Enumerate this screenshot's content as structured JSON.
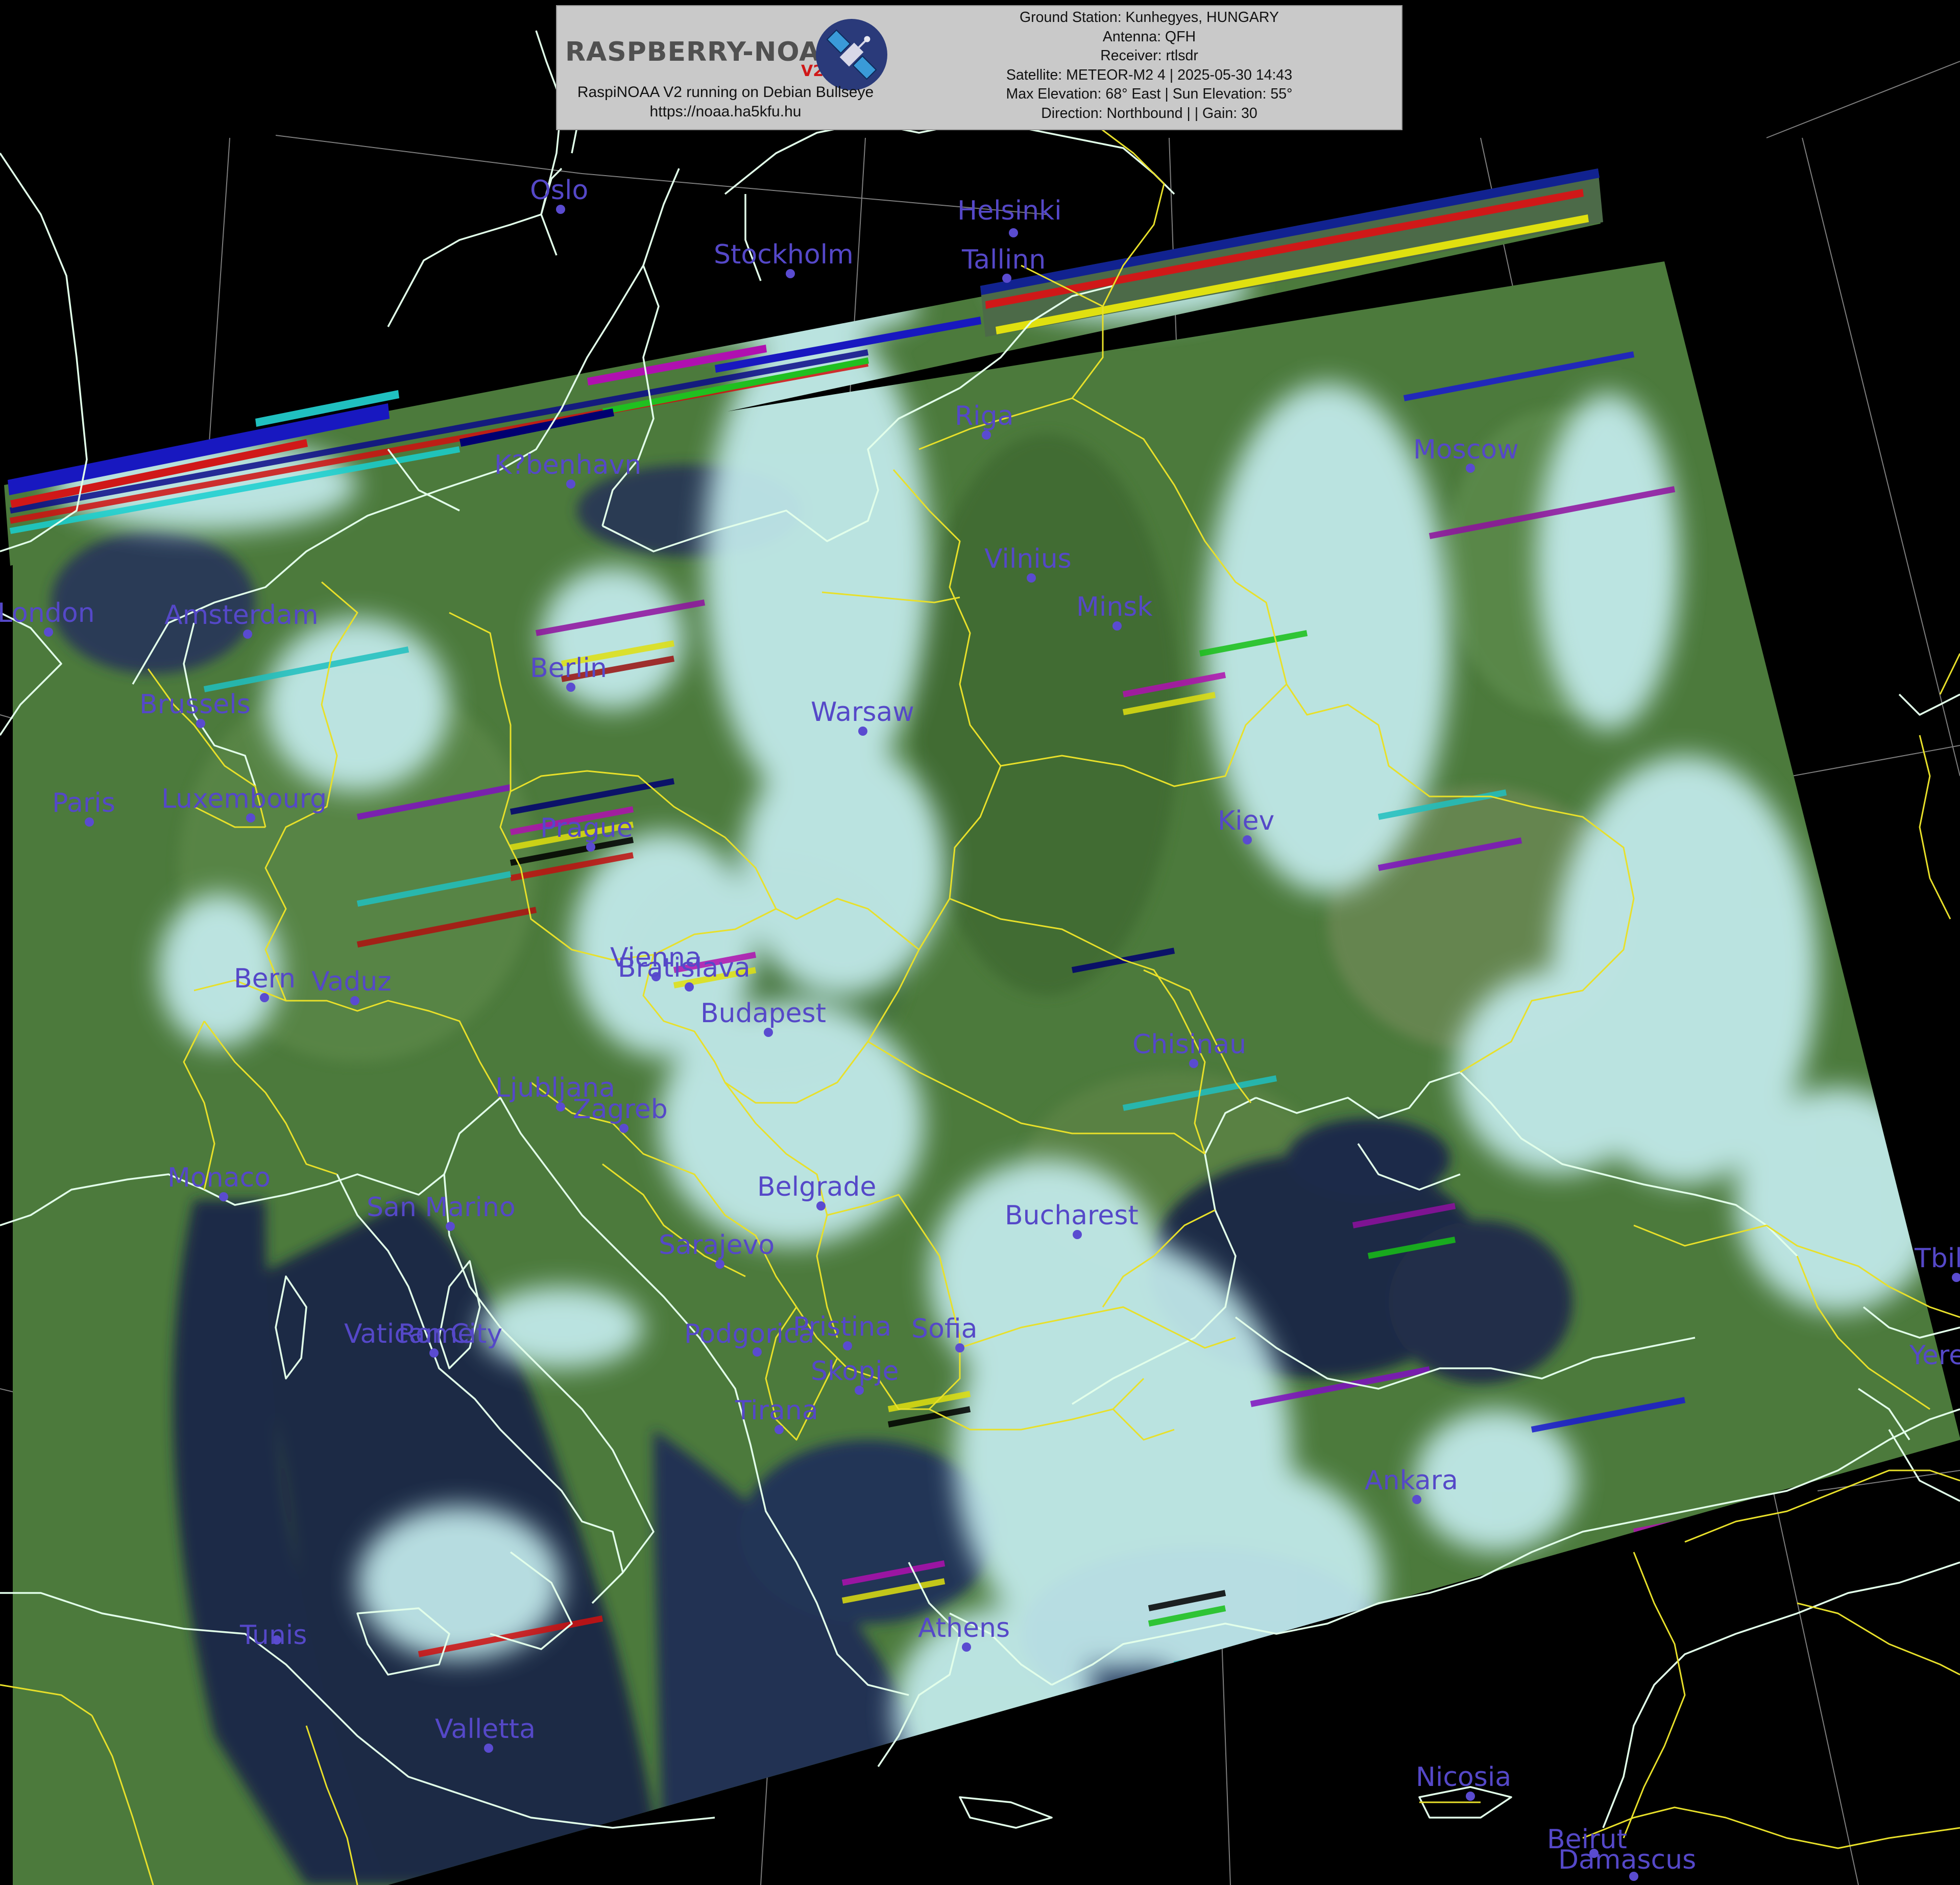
{
  "header": {
    "logo_text": "RASPBERRY-NOAA",
    "logo_badge": "V2",
    "subtitle_line1": "RaspiNOAA V2 running on Debian Bullseye",
    "subtitle_line2": "https://noaa.ha5kfu.hu",
    "ground_station": "Ground Station: Kunhegyes, HUNGARY",
    "antenna": "Antenna: QFH",
    "receiver": "Receiver: rtlsdr",
    "satellite": "Satellite: METEOR-M2 4 | 2025-05-30 14:43",
    "elevation": "Max Elevation: 68° East | Sun Elevation: 55°",
    "direction": "Direction: Northbound | | Gain: 30"
  },
  "colors": {
    "city_label": "#5548c8",
    "city_dot": "#5a4bd0",
    "coastline": "#d8ffe8",
    "border": "#e8e02a",
    "graticule": "#9a9a9a",
    "land": "#4e7a3e",
    "cloud": "#c6ecee",
    "sea": "#1a2942",
    "background": "#000000"
  },
  "cities": [
    {
      "name": "Oslo"
    },
    {
      "name": "Helsinki"
    },
    {
      "name": "Stockholm"
    },
    {
      "name": "Tallinn"
    },
    {
      "name": "Riga"
    },
    {
      "name": "Moscow"
    },
    {
      "name": "K?benhavn"
    },
    {
      "name": "Vilnius"
    },
    {
      "name": "Minsk"
    },
    {
      "name": "London"
    },
    {
      "name": "Amsterdam"
    },
    {
      "name": "Berlin"
    },
    {
      "name": "Brussels"
    },
    {
      "name": "Warsaw"
    },
    {
      "name": "Paris"
    },
    {
      "name": "Luxembourg"
    },
    {
      "name": "Kiev"
    },
    {
      "name": "Prague"
    },
    {
      "name": "Vienna"
    },
    {
      "name": "Bratislava"
    },
    {
      "name": "Bern"
    },
    {
      "name": "Vaduz"
    },
    {
      "name": "Budapest"
    },
    {
      "name": "Chisinau"
    },
    {
      "name": "Ljubljana"
    },
    {
      "name": "Zagreb"
    },
    {
      "name": "Monaco"
    },
    {
      "name": "San Marino"
    },
    {
      "name": "Belgrade"
    },
    {
      "name": "Bucharest"
    },
    {
      "name": "Sarajevo"
    },
    {
      "name": "Tbilisi"
    },
    {
      "name": "Vatican City"
    },
    {
      "name": "Rome"
    },
    {
      "name": "Podgorica"
    },
    {
      "name": "Pristina"
    },
    {
      "name": "Sofia"
    },
    {
      "name": "Skopje"
    },
    {
      "name": "Yerevan"
    },
    {
      "name": "Tirana"
    },
    {
      "name": "Ankara"
    },
    {
      "name": "Tunis"
    },
    {
      "name": "Athens"
    },
    {
      "name": "Valletta"
    },
    {
      "name": "Nicosia"
    },
    {
      "name": "Beirut"
    },
    {
      "name": "Damascus"
    }
  ]
}
